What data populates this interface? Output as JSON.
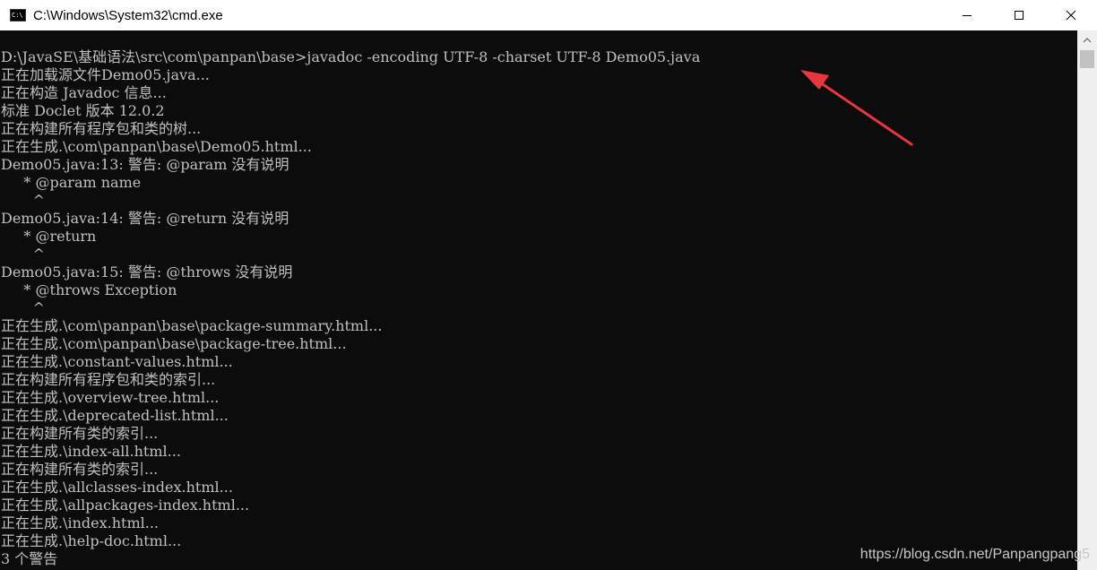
{
  "window": {
    "title": "C:\\Windows\\System32\\cmd.exe",
    "icon_label": "C:\\",
    "icons": {
      "app": "cmd-icon",
      "minimize": "minimize-icon",
      "maximize": "maximize-icon",
      "close": "close-icon"
    }
  },
  "console": {
    "text_color": "#c0c0c0",
    "background": "#0c0c0c",
    "lines": [
      "D:\\JavaSE\\基础语法\\src\\com\\panpan\\base>javadoc -encoding UTF-8 -charset UTF-8 Demo05.java",
      "正在加载源文件Demo05.java...",
      "正在构造 Javadoc 信息...",
      "标准 Doclet 版本 12.0.2",
      "正在构建所有程序包和类的树...",
      "正在生成.\\com\\panpan\\base\\Demo05.html...",
      "Demo05.java:13: 警告: @param 没有说明",
      "     * @param name",
      "       ^",
      "Demo05.java:14: 警告: @return 没有说明",
      "     * @return",
      "       ^",
      "Demo05.java:15: 警告: @throws 没有说明",
      "     * @throws Exception",
      "       ^",
      "正在生成.\\com\\panpan\\base\\package-summary.html...",
      "正在生成.\\com\\panpan\\base\\package-tree.html...",
      "正在生成.\\constant-values.html...",
      "正在构建所有程序包和类的索引...",
      "正在生成.\\overview-tree.html...",
      "正在生成.\\deprecated-list.html...",
      "正在构建所有类的索引...",
      "正在生成.\\index-all.html...",
      "正在构建所有类的索引...",
      "正在生成.\\allclasses-index.html...",
      "正在生成.\\allpackages-index.html...",
      "正在生成.\\index.html...",
      "正在生成.\\help-doc.html...",
      "3 个警告"
    ]
  },
  "annotation": {
    "arrow_color": "#e8373c"
  },
  "watermark": "https://blog.csdn.net/Panpangpang5"
}
